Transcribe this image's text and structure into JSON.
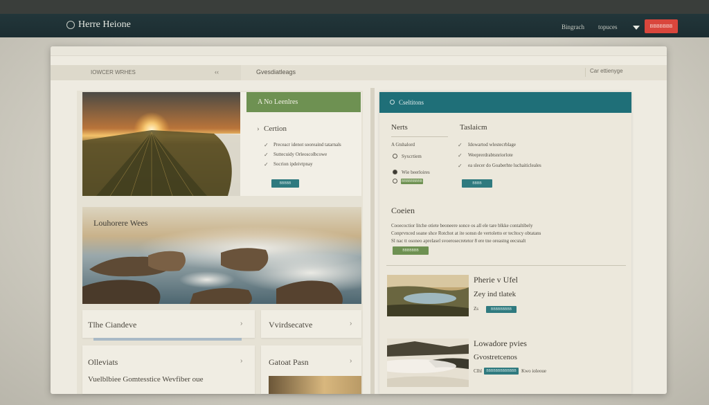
{
  "nav": {
    "brand": "Herre Heione",
    "links": [
      "Bingrach",
      "topuces"
    ],
    "cta_label": "BBBBBBB"
  },
  "subbar": {
    "left_label": "IOWCER WRHES",
    "left_arrow": "‹‹",
    "mid_label": "Gvesdiatleags",
    "right_label": "Car ettienyge"
  },
  "card1": {
    "title": "A No Leenlres",
    "subtitle": "Certion",
    "lines": [
      "Preceacr idenot sooreaind tatarnals",
      "Suttecuidy Orleoscolbcowe",
      "Socrion ipdeivtpnay"
    ],
    "button": "BBBBB"
  },
  "card2": {
    "title": "Louhorere Wees"
  },
  "tiles": [
    {
      "title": "Tlhe Ciandeve",
      "arrow": "›"
    },
    {
      "title": "Vvirdsecatve",
      "arrow": "›"
    },
    {
      "title": "Olleviats",
      "arrow": "›"
    },
    {
      "title": "Gatoat Pasn",
      "arrow": "›"
    }
  ],
  "tile3_footer": "Vuelblbiee Gomtesstice Wevfiber oue",
  "panel": {
    "header": "Cseltitons",
    "col1": {
      "title": "Nerts",
      "items": [
        "A Gtshalord",
        "Syxcrtiem",
        "Wie beerloires"
      ],
      "button": "BBBBBBBBB"
    },
    "col2": {
      "title": "Taslaicm",
      "lines": [
        "Idowartod wlestecrblage",
        "Weeprerdrabtsnriorlote",
        "ea slecer do Goaberhte luchaiticleales"
      ],
      "button": "BBBB"
    },
    "section": {
      "title": "Coeien",
      "lines": [
        "Cooecoctior litche otiete beoneere sonce os all ele tare blkke contaltibely",
        "Conprvnced soane shce Rotchot at ite sonsn de vertoletto er tecltocy obtatans",
        "Sl nac tt osoneo aprelasel svoerosecretetor 8 ere tne oreastng eecsnalt"
      ],
      "button": "BBBBBBB"
    },
    "items": [
      {
        "title": "Pherie v Ufel",
        "subtitle": "Zey ind tlatek",
        "tag": "Zs",
        "button": "BBBBBBBBB"
      },
      {
        "title": "Lowadore pvies",
        "subtitle": "Gvostretcenos",
        "tag": "Clhl",
        "button": "BBBBBBBBBBBBB",
        "after": "Kwo ioleoue"
      }
    ]
  },
  "colors": {
    "navbar": "#1f3236",
    "accent_teal": "#1f6f78",
    "accent_green": "#6e9152",
    "cta_red": "#d9463c"
  }
}
